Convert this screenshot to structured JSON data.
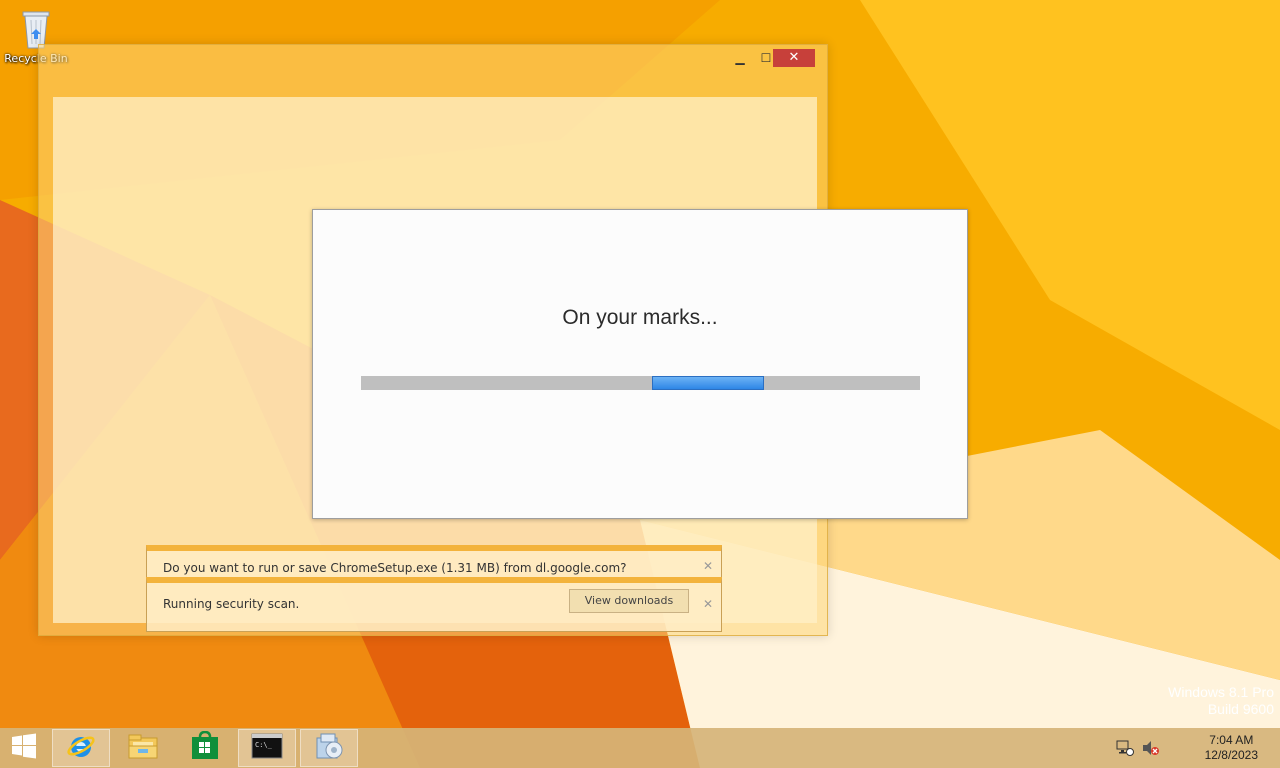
{
  "desktop": {
    "recycle_bin_label": "Recycle Bin",
    "watermark_line1": "Windows 8.1 Pro",
    "watermark_line2": "Build 9600"
  },
  "browser_window": {
    "controls": {
      "minimize": "▁",
      "maximize": "☐",
      "close": "✕"
    },
    "notifications": [
      {
        "text": "Do you want to run or save ChromeSetup.exe (1.31 MB) from dl.google.com?",
        "close": "✕"
      },
      {
        "text": "Running security scan.",
        "button": "View downloads",
        "close": "✕"
      }
    ]
  },
  "installer": {
    "title": "On your marks...",
    "progress_indeterminate": true
  },
  "taskbar": {
    "items": [
      {
        "name": "start-button",
        "icon": "windows-logo-icon"
      },
      {
        "name": "internet-explorer",
        "icon": "ie-icon",
        "active": true
      },
      {
        "name": "file-explorer",
        "icon": "folder-icon"
      },
      {
        "name": "store",
        "icon": "store-icon"
      },
      {
        "name": "command-prompt",
        "icon": "cmd-icon",
        "active": true
      },
      {
        "name": "chrome-installer",
        "icon": "installer-icon",
        "active": true
      }
    ],
    "tray": {
      "network_icon": "network-icon",
      "volume_icon": "volume-muted-icon"
    },
    "clock": {
      "time": "7:04 AM",
      "date": "12/8/2023"
    }
  },
  "colors": {
    "wallpaper": "#f5a800",
    "progress_blue": "#2e86e6",
    "notification_accent": "#f3b33c"
  }
}
